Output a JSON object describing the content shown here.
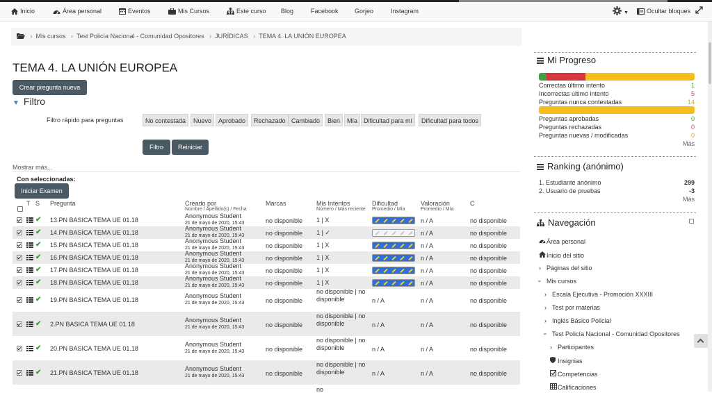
{
  "navbar": {
    "items": [
      {
        "label": "Inicio",
        "icon": "home-icon"
      },
      {
        "label": "Área personal",
        "icon": "dashboard-icon"
      },
      {
        "label": "Eventos",
        "icon": "calendar-icon"
      },
      {
        "label": "Mis Cursos",
        "icon": "briefcase-icon"
      },
      {
        "label": "Este curso",
        "icon": "sitemap-icon"
      },
      {
        "label": "Blog"
      },
      {
        "label": "Facebook"
      },
      {
        "label": "Gorjeo"
      },
      {
        "label": "Instagram"
      }
    ],
    "hide_blocks": "Ocultar bloques"
  },
  "breadcrumb": [
    "Mis cursos",
    "Test Policía Nacional - Comunidad Opositores",
    "JURÍDICAS",
    "TEMA 4. LA UNIÓN EUROPEA"
  ],
  "page": {
    "title": "TEMA 4. LA UNIÓN EUROPEA",
    "new_question": "Crear pregunta nueva",
    "filter_heading": "Filtro",
    "quick_filter_label": "Filtro rápido para preguntas",
    "chips": [
      "No contestada",
      "Nuevo",
      "Aprobado",
      "Rechazado",
      "Cambiado",
      "Bien",
      "Mía",
      "Dificultad para mí",
      "Dificultad para todos"
    ],
    "filter_button": "Filtro",
    "reset_button": "Reiniciar",
    "show_more": "Mostrar más...",
    "with_selected": "Con seleccionadas:",
    "start_exam": "Iniciar Examen"
  },
  "table": {
    "headers": {
      "t": "T",
      "s": "S",
      "question": "Pregunta",
      "created": "Creado por",
      "created_sub": "Nombre / Apellido(s) / Fecha",
      "marks": "Marcas",
      "attempts": "Mis Intentos",
      "attempts_sub": "Número / Más reciente",
      "difficulty": "Dificultad",
      "difficulty_sub": "Promedio / Mía",
      "rating": "Valoración",
      "rating_sub": "Promedio / Mía",
      "c": "C"
    },
    "author": "Anonymous Student",
    "date": "21 de mayo de 2020, 15:43",
    "rows": [
      {
        "name": "13.PN BASICA TEMA UE 01.18",
        "marks": "no disponible",
        "attempts": "1 | X",
        "difficulty": "filled",
        "rating": "n / A",
        "c": "no disponible"
      },
      {
        "name": "14.PN BASICA TEMA UE 01.18",
        "marks": "no disponible",
        "attempts": "1 | ✓",
        "difficulty": "empty",
        "rating": "n / A",
        "c": "no disponible"
      },
      {
        "name": "15.PN BASICA TEMA UE 01.18",
        "marks": "no disponible",
        "attempts": "1 | X",
        "difficulty": "filled",
        "rating": "n / A",
        "c": "no disponible"
      },
      {
        "name": "16.PN BASICA TEMA UE 01.18",
        "marks": "no disponible",
        "attempts": "1 | X",
        "difficulty": "filled",
        "rating": "n / A",
        "c": "no disponible"
      },
      {
        "name": "17.PN BASICA TEMA UE 01.18",
        "marks": "no disponible",
        "attempts": "1 | X",
        "difficulty": "filled",
        "rating": "n / A",
        "c": "no disponible"
      },
      {
        "name": "18.PN BASICA TEMA UE 01.18",
        "marks": "no disponible",
        "attempts": "1 | X",
        "difficulty": "filled",
        "rating": "n / A",
        "c": "no disponible"
      },
      {
        "name": "19.PN BASICA TEMA UE 01.18",
        "marks": "no disponible",
        "attempts": "no disponible | no disponible",
        "difficulty": "n / A",
        "rating": "n / A",
        "c": "no disponible"
      },
      {
        "name": "2.PN BASICA TEMA UE 01.18",
        "marks": "no disponible",
        "attempts": "no disponible | no disponible",
        "difficulty": "n / A",
        "rating": "n / A",
        "c": "no disponible"
      },
      {
        "name": "20.PN BASICA TEMA UE 01.18",
        "marks": "no disponible",
        "attempts": "no disponible | no disponible",
        "difficulty": "n / A",
        "rating": "n / A",
        "c": "no disponible"
      },
      {
        "name": "21.PN BASICA TEMA UE 01.18",
        "marks": "no disponible",
        "attempts": "no disponible | no disponible",
        "difficulty": "n / A",
        "rating": "n / A",
        "c": "no disponible"
      }
    ],
    "partial_text": "no"
  },
  "progress": {
    "title": "Mi Progreso",
    "bar1": [
      {
        "fraction": 0.05,
        "color": "#3da33d"
      },
      {
        "fraction": 0.25,
        "color": "#d9373f"
      },
      {
        "fraction": 0.7,
        "color": "#f5bd1f"
      }
    ],
    "bar2": [
      {
        "fraction": 1.0,
        "color": "#f5bd1f"
      }
    ],
    "stats1": [
      {
        "label": "Correctas último intento",
        "value": "1",
        "color": "#3da33d"
      },
      {
        "label": "Incorrectas último intento",
        "value": "5",
        "color": "#d9373f"
      },
      {
        "label": "Preguntas nunca contestadas",
        "value": "14",
        "color": "#e0a612"
      }
    ],
    "stats2": [
      {
        "label": "Preguntas aprobadas",
        "value": "0",
        "color": "#3da33d"
      },
      {
        "label": "Preguntas rechazadas",
        "value": "0",
        "color": "#d9373f"
      },
      {
        "label": "Preguntas nuevas / modificadas",
        "value": "0",
        "color": "#e0a612"
      }
    ],
    "more": "Más"
  },
  "ranking": {
    "title": "Ranking (anónimo)",
    "rows": [
      {
        "label": "1. Estudiante anónimo",
        "value": "299"
      },
      {
        "label": "2. Usuario de pruebas",
        "value": "-3"
      }
    ],
    "more": "Más"
  },
  "navigation": {
    "title": "Navegación",
    "items": [
      {
        "label": "Área personal",
        "icon": "dashboard-icon"
      },
      {
        "label": "Inicio del sitio",
        "icon": "home-icon"
      },
      {
        "label": "Páginas del sitio",
        "icon": "chevron-right-icon"
      },
      {
        "label": "Mis cursos",
        "icon": "chevron-down-icon"
      },
      {
        "label": "Escala Ejecutiva - Promoción XXXIII",
        "icon": "chevron-right-icon"
      },
      {
        "label": "Test por materias",
        "icon": "chevron-right-icon"
      },
      {
        "label": "Inglés Básico Policial",
        "icon": "chevron-right-icon"
      },
      {
        "label": "Test Policía Nacional - Comunidad Opositores",
        "icon": "chevron-down-icon"
      },
      {
        "label": "Participantes",
        "icon": "chevron-right-icon"
      },
      {
        "label": "Insignias",
        "icon": "shield-icon"
      },
      {
        "label": "Competencias",
        "icon": "checkbox-icon"
      },
      {
        "label": "Calificaciones",
        "icon": "table-icon"
      }
    ]
  }
}
